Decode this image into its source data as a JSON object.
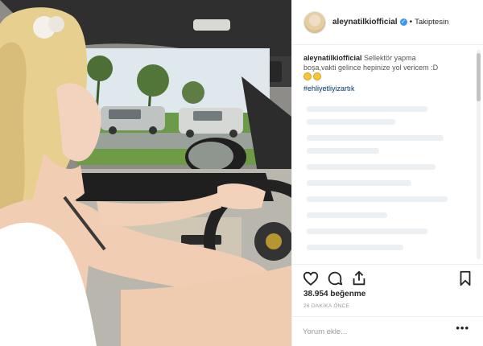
{
  "header": {
    "username": "aleynatilkiofficial",
    "verified_icon": "verified-badge-icon",
    "separator": "•",
    "follow_status": "Takiptesin"
  },
  "caption": {
    "username": "aleynatilkiofficial",
    "text_line1": "Sellektör yapma",
    "text_line2": "boşa,vakti gelince hepinize yol vericem :D",
    "hashtag": "#ehliyetliyizartık"
  },
  "actions": {
    "like_icon": "heart-icon",
    "comment_icon": "comment-icon",
    "share_icon": "share-icon",
    "save_icon": "bookmark-icon"
  },
  "likes_text": "38.954 beğenme",
  "time_ago": "26 DAKİKA ÖNCE",
  "comment_box": {
    "placeholder": "Yorum ekle...",
    "more_label": "•••"
  },
  "colors": {
    "verified": "#3897f0",
    "hashtag": "#003569",
    "border": "#efefef"
  }
}
